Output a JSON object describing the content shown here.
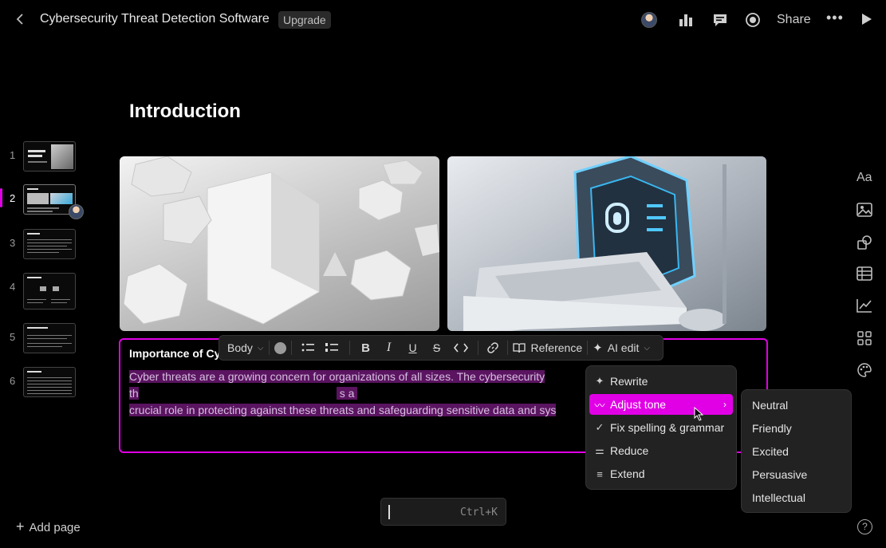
{
  "header": {
    "title": "Cybersecurity Threat Detection Software",
    "upgrade": "Upgrade",
    "share": "Share",
    "more": "•••"
  },
  "thumbnails": [
    {
      "num": "1"
    },
    {
      "num": "2"
    },
    {
      "num": "3"
    },
    {
      "num": "4"
    },
    {
      "num": "5"
    },
    {
      "num": "6"
    }
  ],
  "sidebar": {
    "add_page": "Add page"
  },
  "slide": {
    "heading": "Introduction",
    "subheading": "Importance of Cy",
    "paragraph": "Cyber threats are a growing concern for organizations of all sizes. The cybersecurity th",
    "paragraph_tail": "s a",
    "paragraph_line2": "crucial role in protecting against these threats and safeguarding sensitive data and sys"
  },
  "toolbar": {
    "style": "Body",
    "reference": "Reference",
    "ai_edit": "AI edit"
  },
  "ai_menu": {
    "items": [
      {
        "label": "Rewrite",
        "icon": "sparkle-icon"
      },
      {
        "label": "Adjust tone",
        "icon": "wave-icon"
      },
      {
        "label": "Fix spelling & grammar",
        "icon": "check-icon"
      },
      {
        "label": "Reduce",
        "icon": "reduce-icon"
      },
      {
        "label": "Extend",
        "icon": "extend-icon"
      }
    ]
  },
  "tone_menu": {
    "items": [
      "Neutral",
      "Friendly",
      "Excited",
      "Persuasive",
      "Intellectual"
    ]
  },
  "command": {
    "shortcut": "Ctrl+K"
  },
  "help": "?",
  "colors": {
    "accent": "#e100e6",
    "background": "#000000",
    "menu": "#222222"
  }
}
